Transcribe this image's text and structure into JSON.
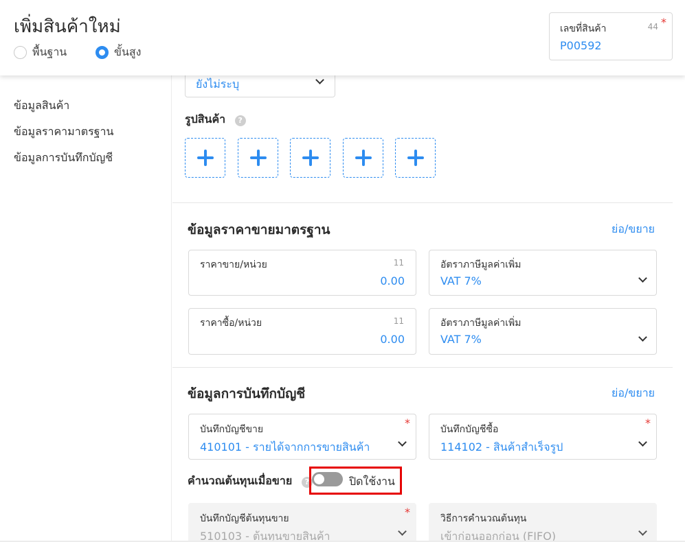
{
  "header": {
    "title": "เพิ่มสินค้าใหม่",
    "modes": [
      {
        "label": "พื้นฐาน",
        "selected": false
      },
      {
        "label": "ขั้นสูง",
        "selected": true
      }
    ],
    "product_code": {
      "label": "เลขที่สินค้า",
      "count": "44",
      "value": "P00592",
      "required": true
    }
  },
  "sidebar": {
    "items": [
      {
        "label": "ข้อมูลสินค้า"
      },
      {
        "label": "ข้อมูลราคามาตรฐาน"
      },
      {
        "label": "ข้อมูลการบันทึกบัญชี"
      }
    ]
  },
  "product_info": {
    "select_value": "ยังไม่ระบุ",
    "photos_label": "รูปสินค้า",
    "help_glyph": "?",
    "photo_slot_count": 5
  },
  "pricing": {
    "title": "ข้อมูลราคาขายมาตรฐาน",
    "collapse_label": "ย่อ/ขยาย",
    "sell_price": {
      "label": "ราคาขาย/หน่วย",
      "count": "11",
      "value": "0.00"
    },
    "sell_vat": {
      "label": "อัตราภาษีมูลค่าเพิ่ม",
      "value": "VAT 7%"
    },
    "buy_price": {
      "label": "ราคาซื้อ/หน่วย",
      "count": "11",
      "value": "0.00"
    },
    "buy_vat": {
      "label": "อัตราภาษีมูลค่าเพิ่ม",
      "value": "VAT 7%"
    }
  },
  "accounting": {
    "title": "ข้อมูลการบันทึกบัญชี",
    "collapse_label": "ย่อ/ขยาย",
    "sales_account": {
      "label": "บันทึกบัญชีขาย",
      "value": "410101 - รายได้จากการขายสินค้า",
      "required": true
    },
    "purchase_account": {
      "label": "บันทึกบัญชีซื้อ",
      "value": "114102 - สินค้าสำเร็จรูป",
      "required": true
    },
    "cost_calc": {
      "label": "คำนวณต้นทุนเมื่อขาย",
      "toggle_label": "ปิดใช้งาน",
      "enabled": false
    },
    "cost_account": {
      "label": "บันทึกบัญชีต้นทุนขาย",
      "value": "510103 - ต้นทุนขายสินค้า",
      "required": true
    },
    "cost_method": {
      "label": "วิธีการคำนวณต้นทุน",
      "value": "เข้าก่อนออกก่อน (FIFO)"
    }
  },
  "colors": {
    "accent": "#2d8cf0",
    "required": "#e53935",
    "highlight": "#e60000",
    "toggle_off": "#9a9a9a"
  },
  "icons": [
    "help-icon",
    "plus-icon",
    "chevron-down-icon",
    "radio-icon"
  ]
}
